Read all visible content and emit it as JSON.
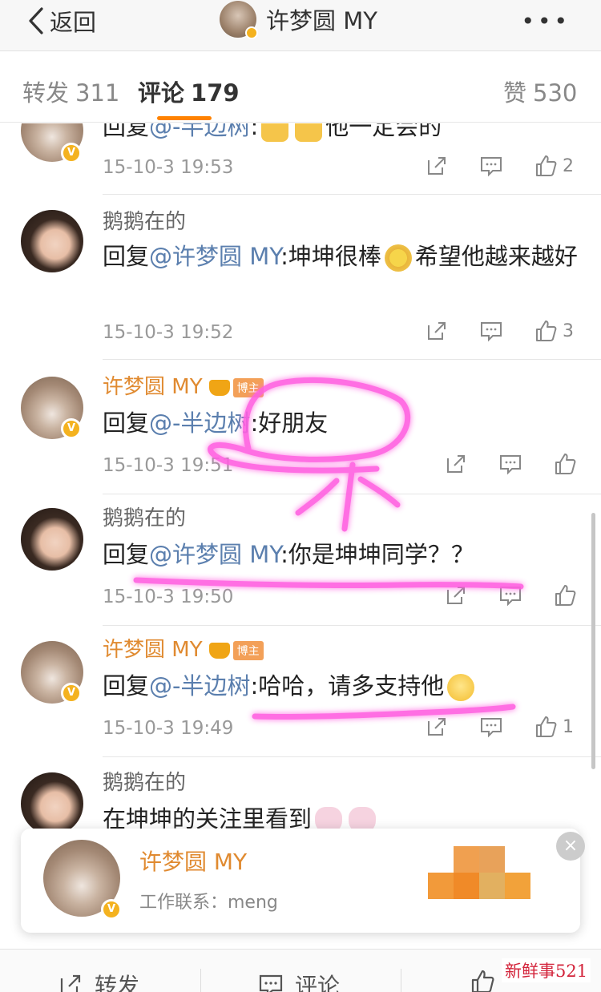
{
  "nav": {
    "back_label": "返回",
    "title": "许梦圆 MY",
    "more_label": "•••"
  },
  "tabs": [
    {
      "label": "转发",
      "count": "311"
    },
    {
      "label": "评论",
      "count": "179"
    },
    {
      "label": "赞",
      "count": "530"
    }
  ],
  "comments": [
    {
      "name": "",
      "text_prefix": "回复",
      "mention": "@-半边树",
      "text": ":",
      "text_tail": "他一定会的",
      "time": "15-10-3 19:53",
      "likes": "2"
    },
    {
      "name": "鹅鹅在的",
      "text_prefix": "回复",
      "mention": "@许梦圆 MY",
      "text": ":坤坤很棒",
      "text_tail": "希望他越来越好",
      "time": "15-10-3 19:52",
      "likes": "3"
    },
    {
      "name": "许梦圆 MY",
      "badge": "博主",
      "text_prefix": "回复",
      "mention": "@-半边树",
      "text": ":好朋友",
      "time": "15-10-3 19:51",
      "likes": ""
    },
    {
      "name": "鹅鹅在的",
      "text_prefix": "回复",
      "mention": "@许梦圆 MY",
      "text": ":你是坤坤同学？？",
      "time": "15-10-3 19:50",
      "likes": ""
    },
    {
      "name": "许梦圆 MY",
      "badge": "博主",
      "text_prefix": "回复",
      "mention": "@-半边树",
      "text": ":哈哈，请多支持他",
      "time": "15-10-3 19:49",
      "likes": "1"
    },
    {
      "name": "鹅鹅在的",
      "text": "在坤坤的关注里看到"
    }
  ],
  "card": {
    "name": "许梦圆 MY",
    "contact": "工作联系：meng"
  },
  "bottom": {
    "repost": "转发",
    "comment": "评论"
  },
  "watermark": "新鲜事521",
  "colors": {
    "accent": "#ff8200",
    "link": "#5b7fae",
    "owner_name": "#e08a30",
    "doodle": "#ff4fd8"
  }
}
